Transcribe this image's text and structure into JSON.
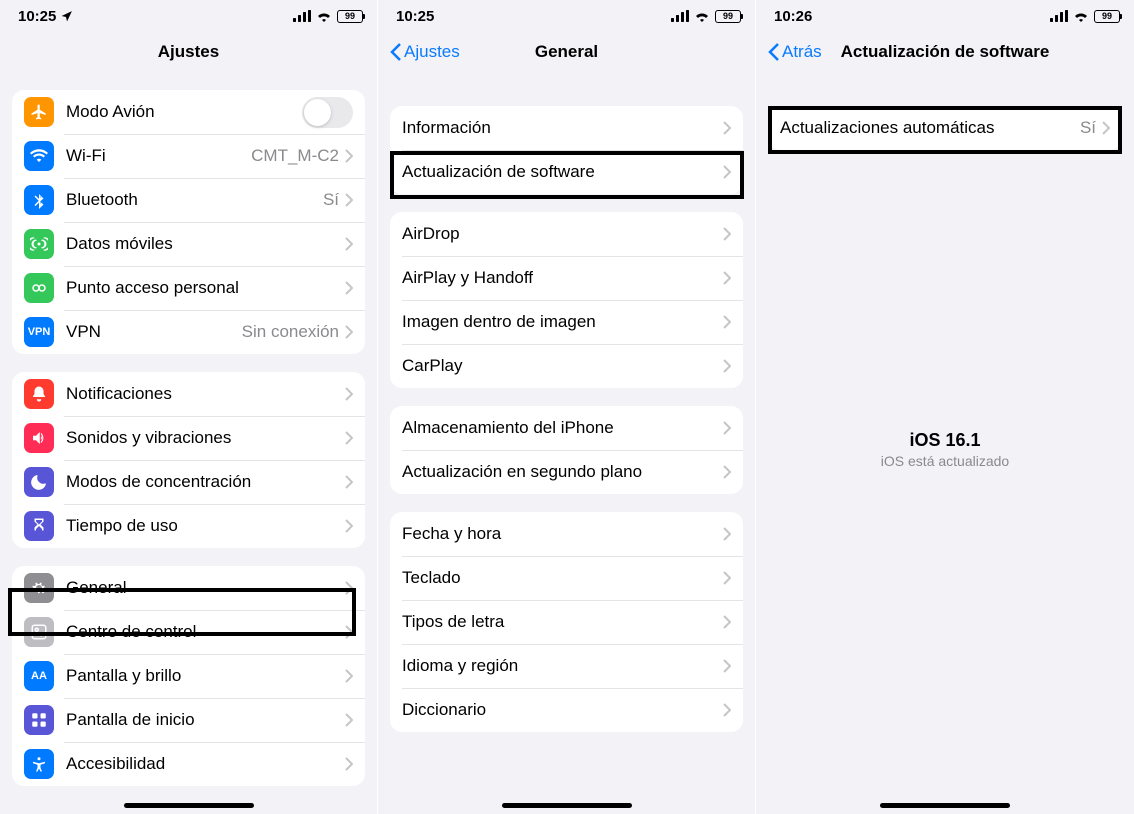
{
  "screen1": {
    "status_time": "10:25",
    "battery": "99",
    "title": "Ajustes",
    "group1": [
      {
        "label": "Modo Avión",
        "value": "",
        "toggle": true
      },
      {
        "label": "Wi-Fi",
        "value": "CMT_M-C2"
      },
      {
        "label": "Bluetooth",
        "value": "Sí"
      },
      {
        "label": "Datos móviles",
        "value": ""
      },
      {
        "label": "Punto acceso personal",
        "value": ""
      },
      {
        "label": "VPN",
        "value": "Sin conexión"
      }
    ],
    "group2": [
      {
        "label": "Notificaciones"
      },
      {
        "label": "Sonidos y vibraciones"
      },
      {
        "label": "Modos de concentración"
      },
      {
        "label": "Tiempo de uso"
      }
    ],
    "group3": [
      {
        "label": "General"
      },
      {
        "label": "Centro de control"
      },
      {
        "label": "Pantalla y brillo"
      },
      {
        "label": "Pantalla de inicio"
      },
      {
        "label": "Accesibilidad"
      }
    ]
  },
  "screen2": {
    "status_time": "10:25",
    "battery": "99",
    "back": "Ajustes",
    "title": "General",
    "group1": [
      {
        "label": "Información"
      },
      {
        "label": "Actualización de software"
      }
    ],
    "group2": [
      {
        "label": "AirDrop"
      },
      {
        "label": "AirPlay y Handoff"
      },
      {
        "label": "Imagen dentro de imagen"
      },
      {
        "label": "CarPlay"
      }
    ],
    "group3": [
      {
        "label": "Almacenamiento del iPhone"
      },
      {
        "label": "Actualización en segundo plano"
      }
    ],
    "group4": [
      {
        "label": "Fecha y hora"
      },
      {
        "label": "Teclado"
      },
      {
        "label": "Tipos de letra"
      },
      {
        "label": "Idioma y región"
      },
      {
        "label": "Diccionario"
      }
    ]
  },
  "screen3": {
    "status_time": "10:26",
    "battery": "99",
    "back": "Atrás",
    "title": "Actualización de software",
    "row_label": "Actualizaciones automáticas",
    "row_value": "Sí",
    "version": "iOS 16.1",
    "status": "iOS está actualizado"
  }
}
